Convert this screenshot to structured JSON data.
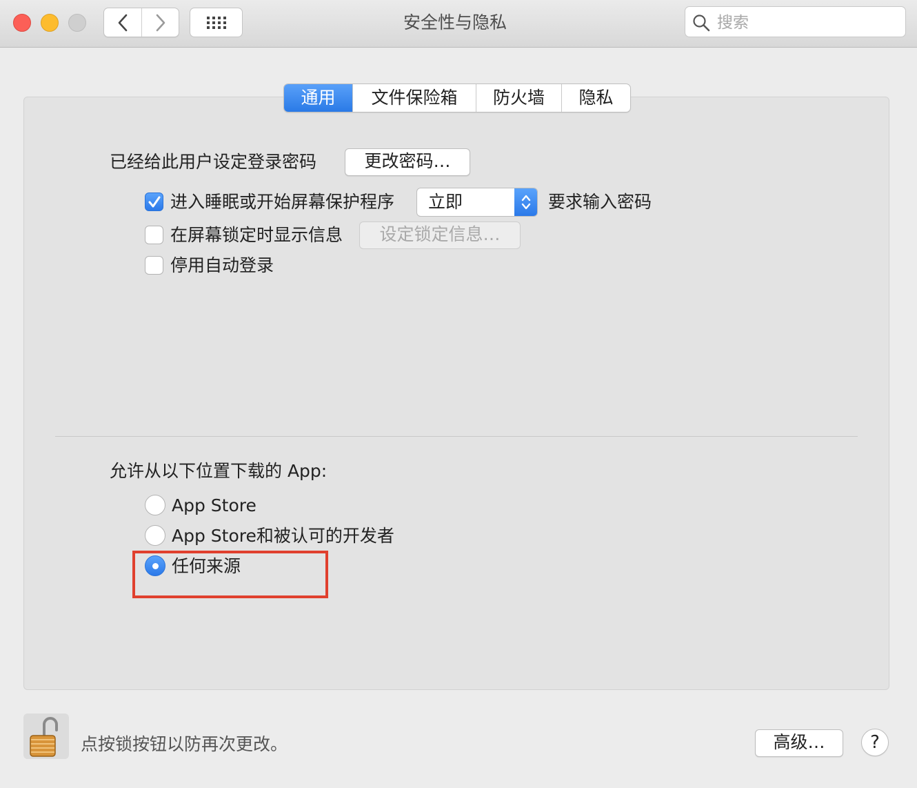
{
  "window": {
    "title": "安全性与隐私"
  },
  "search": {
    "placeholder": "搜索"
  },
  "tabs": [
    {
      "label": "通用",
      "active": true
    },
    {
      "label": "文件保险箱",
      "active": false
    },
    {
      "label": "防火墙",
      "active": false
    },
    {
      "label": "隐私",
      "active": false
    }
  ],
  "general": {
    "password_set_label": "已经给此用户设定登录密码",
    "change_password_button": "更改密码…",
    "require_password": {
      "checked": true,
      "label": "进入睡眠或开始屏幕保护程序",
      "popup_value": "立即",
      "suffix": "要求输入密码"
    },
    "show_message": {
      "checked": false,
      "label": "在屏幕锁定时显示信息",
      "button": "设定锁定信息…"
    },
    "disable_auto_login": {
      "checked": false,
      "label": "停用自动登录"
    },
    "allow_apps_label": "允许从以下位置下载的 App:",
    "app_sources": [
      {
        "label": "App Store",
        "selected": false
      },
      {
        "label": "App Store和被认可的开发者",
        "selected": false
      },
      {
        "label": "任何来源",
        "selected": true
      }
    ]
  },
  "footer": {
    "lock_text": "点按锁按钮以防再次更改。",
    "advanced_button": "高级…",
    "help_button": "?"
  },
  "colors": {
    "accent": "#2f7fe9",
    "highlight_box": "#e0402e",
    "close": "#fc5f57",
    "minimize": "#fdbc2e",
    "zoom": "#cfcfcf"
  },
  "icons": [
    "close-icon",
    "minimize-icon",
    "zoom-icon",
    "chevron-left-icon",
    "chevron-right-icon",
    "grid-icon",
    "search-icon",
    "checkmark-icon",
    "stepper-icon",
    "lock-icon"
  ]
}
